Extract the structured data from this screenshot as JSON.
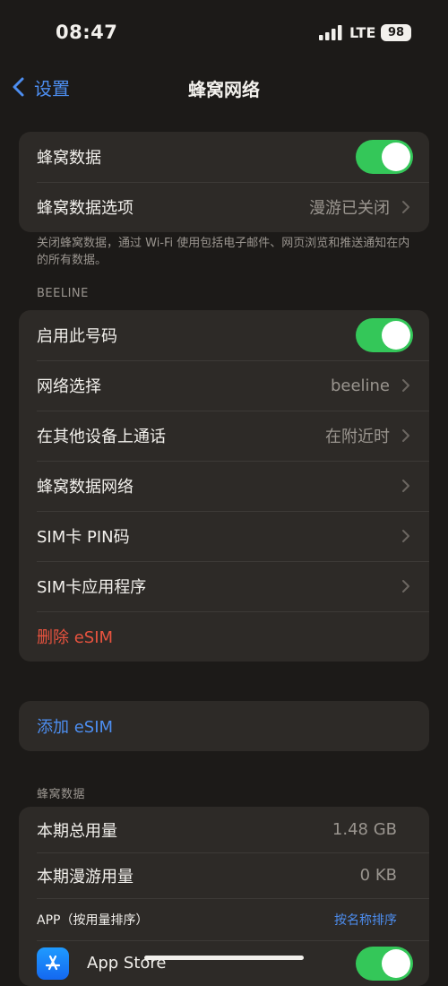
{
  "status_bar": {
    "time": "08:47",
    "network": "LTE",
    "battery": "98"
  },
  "nav": {
    "back_label": "设置",
    "title": "蜂窝网络"
  },
  "group_cellular": {
    "cellular_data": {
      "label": "蜂窝数据",
      "on": true
    },
    "data_options": {
      "label": "蜂窝数据选项",
      "value": "漫游已关闭"
    }
  },
  "footnote": "关闭蜂窝数据，通过 Wi-Fi 使用包括电子邮件、网页浏览和推送通知在内的所有数据。",
  "beeline_section": {
    "header": "BEELINE",
    "enable_line": {
      "label": "启用此号码",
      "on": true
    },
    "network_selection": {
      "label": "网络选择",
      "value": "beeline"
    },
    "calls_other_devices": {
      "label": "在其他设备上通话",
      "value": "在附近时"
    },
    "cellular_data_network": {
      "label": "蜂窝数据网络"
    },
    "sim_pin": {
      "label": "SIM卡 PIN码"
    },
    "sim_apps": {
      "label": "SIM卡应用程序"
    },
    "delete_esim": {
      "label": "删除 eSIM"
    }
  },
  "add_esim": {
    "label": "添加 eSIM"
  },
  "usage_section": {
    "header": "蜂窝数据",
    "current_period": {
      "label": "本期总用量",
      "value": "1.48 GB"
    },
    "current_roaming": {
      "label": "本期漫游用量",
      "value": "0 KB"
    },
    "apps_header": {
      "label": "APP（按用量排序）",
      "sort_link": "按名称排序"
    },
    "apps": [
      {
        "name": "App Store",
        "on": true
      }
    ]
  },
  "colors": {
    "accent": "#4d8ef0",
    "toggle_on": "#34c759",
    "destructive": "#e8533f"
  }
}
